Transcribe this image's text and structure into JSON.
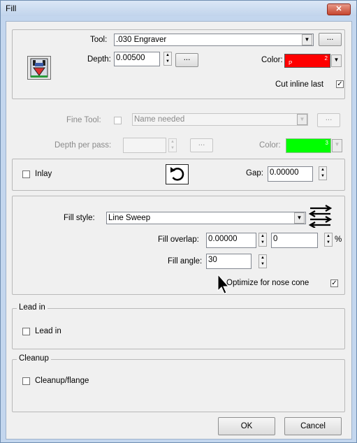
{
  "window": {
    "title": "Fill",
    "close_label": "✕"
  },
  "tool_section": {
    "tool_label": "Tool:",
    "tool_value": ".030 Engraver",
    "tool_browse_label": "...",
    "depth_label": "Depth:",
    "depth_value": "0.00500",
    "depth_browse_label": "...",
    "color_label": "Color:",
    "color_value": "#ff0000",
    "color_swatch_p": "P",
    "color_swatch_num": "2",
    "cut_inline_last_label": "Cut inline last",
    "cut_inline_last_checked": true
  },
  "fine_tool": {
    "fine_tool_label": "Fine Tool:",
    "fine_tool_checked": false,
    "fine_tool_value": "Name needed",
    "fine_tool_browse_label": "...",
    "depth_per_pass_label": "Depth per pass:",
    "depth_per_pass_value": "",
    "depth_per_pass_browse_label": "...",
    "color_label": "Color:",
    "color_value": "#00ff00",
    "color_swatch_num": "3"
  },
  "inlay": {
    "inlay_label": "Inlay",
    "inlay_checked": false,
    "gap_label": "Gap:",
    "gap_value": "0.00000"
  },
  "fill": {
    "fill_style_label": "Fill style:",
    "fill_style_value": "Line Sweep",
    "fill_overlap_label": "Fill overlap:",
    "fill_overlap_value": "0.00000",
    "fill_overlap_percent_value": "0",
    "percent_label": "%",
    "fill_angle_label": "Fill angle:",
    "fill_angle_value": "30",
    "optimize_label": "Optimize for nose cone",
    "optimize_checked": true
  },
  "lead_in": {
    "group_label": "Lead in",
    "checkbox_label": "Lead in",
    "checked": false
  },
  "cleanup": {
    "group_label": "Cleanup",
    "checkbox_label": "Cleanup/flange",
    "checked": false
  },
  "buttons": {
    "ok_label": "OK",
    "cancel_label": "Cancel"
  }
}
